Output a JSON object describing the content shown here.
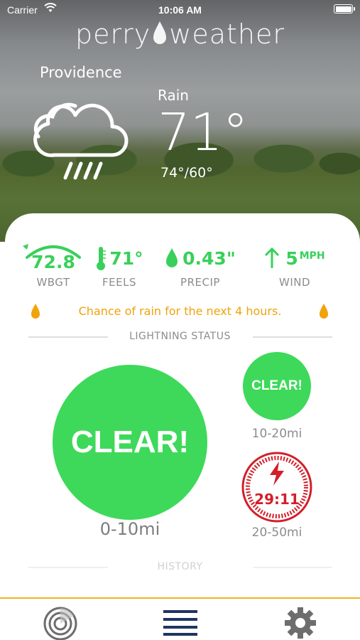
{
  "status_bar": {
    "carrier": "Carrier",
    "time": "10:06 AM"
  },
  "header": {
    "logo_left": "perry",
    "logo_right": "weather",
    "location": "Providence",
    "condition": "Rain",
    "temperature": "71°",
    "hi_lo": "74°/60°",
    "weather_icon": "cloud-rain-icon"
  },
  "metrics": [
    {
      "value": "72.8",
      "label": "WBGT",
      "icon": "wbgt-gauge-icon"
    },
    {
      "value": "71°",
      "label": "FEELS",
      "icon": "thermometer-icon"
    },
    {
      "value": "0.43\"",
      "label": "PRECIP",
      "icon": "raindrop-icon"
    },
    {
      "value": "5",
      "unit": "MPH",
      "label": "WIND",
      "icon": "arrow-up-icon"
    }
  ],
  "rain_notice": "Chance of rain for the next 4 hours.",
  "lightning": {
    "title": "LIGHTNING STATUS",
    "zone1": {
      "status": "CLEAR!",
      "range": "0-10mi"
    },
    "zone2": {
      "status": "CLEAR!",
      "range": "10-20mi"
    },
    "zone3": {
      "countdown": "29:11",
      "range": "20-50mi"
    }
  },
  "history_title": "HISTORY",
  "colors": {
    "green": "#3ed95a",
    "amber": "#f0a30a",
    "red": "#d21f2a",
    "tab_border": "#f1b321"
  },
  "tabs": [
    {
      "name": "radar",
      "icon": "radar-icon"
    },
    {
      "name": "menu",
      "icon": "menu-icon"
    },
    {
      "name": "settings",
      "icon": "gear-icon"
    }
  ]
}
